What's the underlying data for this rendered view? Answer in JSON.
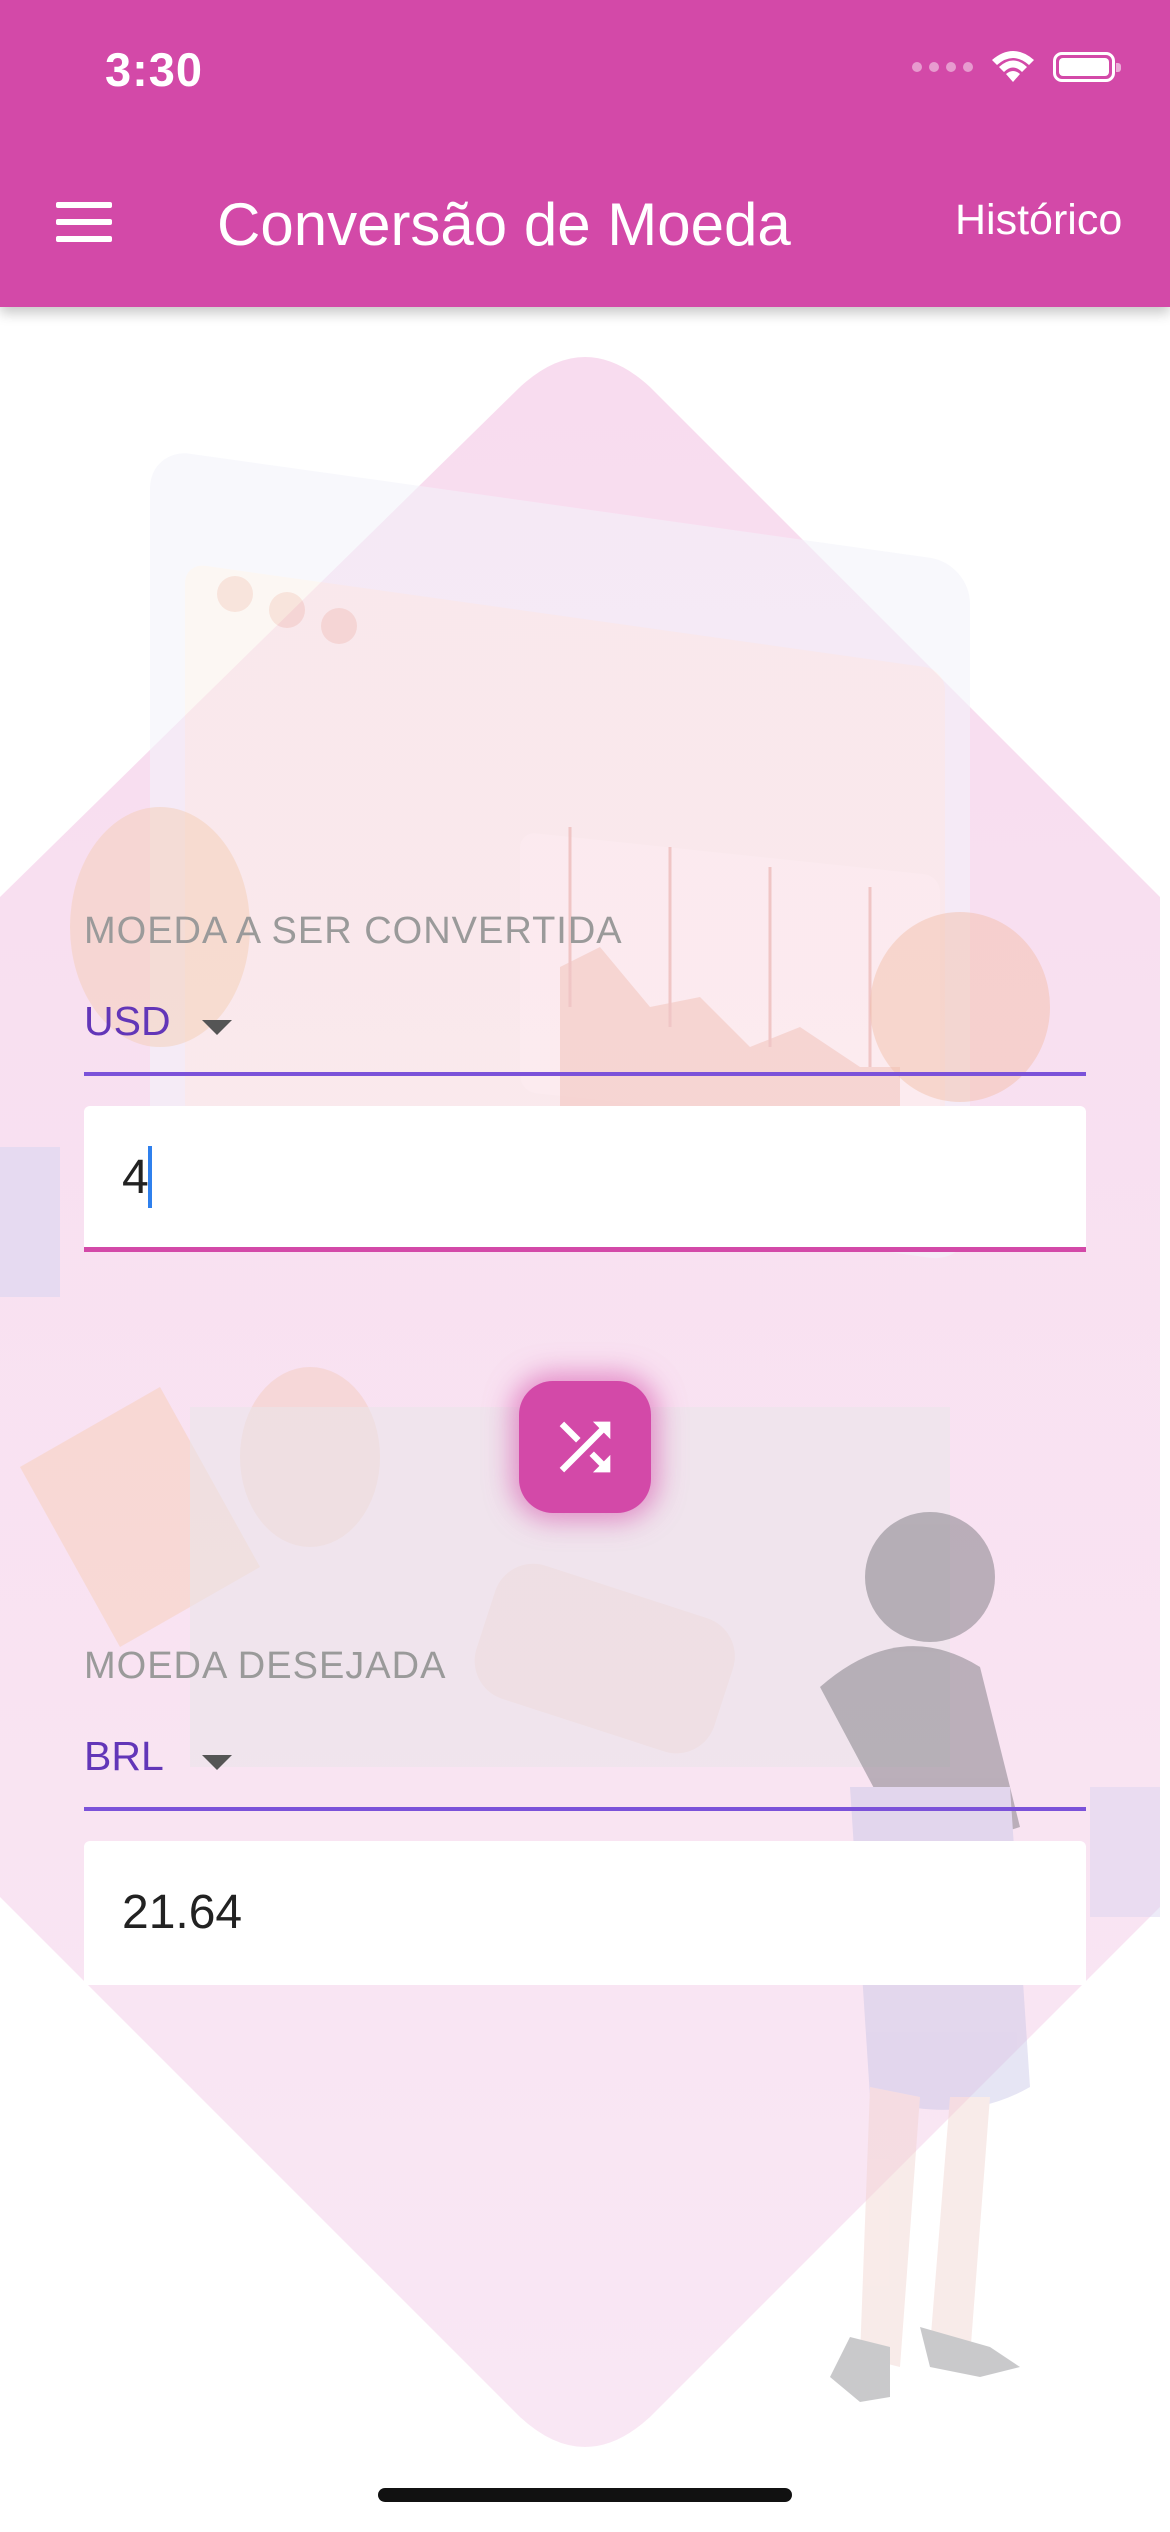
{
  "status_bar": {
    "time": "3:30"
  },
  "app_bar": {
    "menu_icon": "hamburger-menu-icon",
    "title": "Conversão de Moeda",
    "history_label": "Histórico"
  },
  "from": {
    "label": "MOEDA A SER CONVERTIDA",
    "currency": "USD",
    "amount": "4"
  },
  "swap": {
    "icon": "shuffle-icon"
  },
  "to": {
    "label": "MOEDA DESEJADA",
    "currency": "BRL",
    "result": "21.64"
  },
  "colors": {
    "primary": "#d349a8",
    "accent": "#7b52d9",
    "dropdown_text": "#6236b8"
  }
}
